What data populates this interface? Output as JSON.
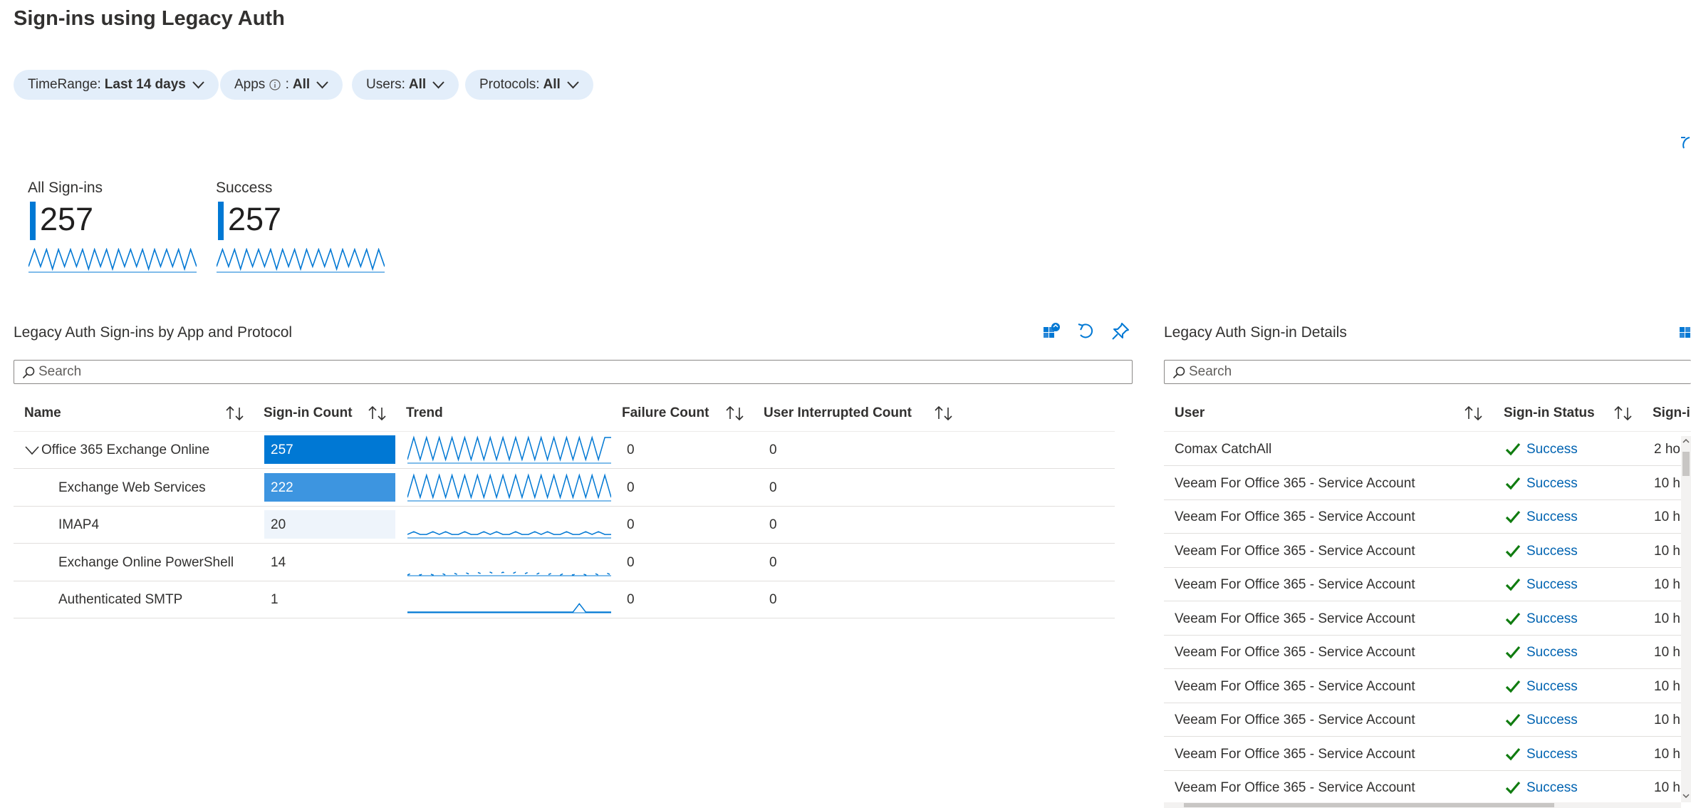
{
  "page": {
    "title": "Sign-ins using Legacy Auth"
  },
  "filters": [
    {
      "label": "TimeRange",
      "value": "Last 14 days",
      "has_info": false
    },
    {
      "label": "Apps",
      "value": "All",
      "has_info": true
    },
    {
      "label": "Users",
      "value": "All",
      "has_info": false
    },
    {
      "label": "Protocols",
      "value": "All",
      "has_info": false
    }
  ],
  "kpis": [
    {
      "label": "All Sign-ins",
      "value": "257",
      "spark": [
        2,
        9,
        2,
        9,
        1,
        9,
        2,
        9,
        2,
        9,
        1,
        9,
        2,
        9,
        1,
        9,
        2,
        9,
        2,
        9,
        1,
        9,
        2,
        9,
        2,
        9,
        1,
        9,
        2
      ]
    },
    {
      "label": "Success",
      "value": "257",
      "spark": [
        2,
        9,
        2,
        9,
        1,
        9,
        2,
        9,
        2,
        9,
        1,
        9,
        2,
        9,
        1,
        9,
        2,
        9,
        2,
        9,
        1,
        9,
        2,
        9,
        2,
        9,
        1,
        9,
        2
      ]
    }
  ],
  "apps_card": {
    "title": "Legacy Auth Sign-ins by App and Protocol",
    "search_placeholder": "Search",
    "columns": [
      "Name",
      "Sign-in Count",
      "Trend",
      "Failure Count",
      "User Interrupted Count"
    ],
    "rows": [
      {
        "name": "Office 365 Exchange Online",
        "count": "257",
        "count_value": 257,
        "failure": "0",
        "interrupted": "0",
        "expandable": true,
        "bar_color": "#0078d4",
        "bar_text_color": "#ffffff",
        "trend": [
          1,
          9,
          1,
          9,
          1,
          9,
          1,
          9,
          1,
          9,
          1,
          9,
          1,
          9,
          1,
          9,
          1,
          9,
          1,
          9,
          1,
          9,
          1,
          9,
          1,
          9,
          1,
          9,
          1,
          9,
          1,
          9,
          9
        ]
      },
      {
        "name": "Exchange Web Services",
        "count": "222",
        "count_value": 222,
        "failure": "0",
        "interrupted": "0",
        "expandable": false,
        "bar_color": "#3d95e0",
        "bar_text_color": "#ffffff",
        "trend": [
          1,
          9,
          1,
          9,
          1,
          9,
          1,
          9,
          1,
          9,
          1,
          9,
          1,
          9,
          1,
          9,
          1,
          9,
          1,
          9,
          1,
          9,
          1,
          9,
          1,
          9,
          1,
          9,
          1,
          9,
          1,
          9,
          1
        ]
      },
      {
        "name": "IMAP4",
        "count": "20",
        "count_value": 20,
        "failure": "0",
        "interrupted": "0",
        "expandable": false,
        "bar_color": "#eef4fb",
        "bar_text_color": "#323130",
        "trend": [
          1,
          2,
          1,
          1,
          2,
          1,
          2,
          1,
          1,
          2,
          1,
          1,
          2,
          1,
          2,
          1,
          1,
          2,
          1,
          1,
          2,
          1,
          2,
          1,
          1,
          2,
          1,
          1,
          2,
          1,
          2,
          1,
          1
        ]
      },
      {
        "name": "Exchange Online PowerShell",
        "count": "14",
        "count_value": 14,
        "failure": "0",
        "interrupted": "0",
        "expandable": false,
        "bar_color": "#ffffff",
        "bar_text_color": "#323130",
        "trend": [
          0,
          1,
          0,
          1,
          0,
          1,
          0,
          1,
          0,
          1,
          0,
          1,
          0,
          1,
          0,
          1,
          0,
          1,
          0,
          1,
          0,
          1,
          0,
          1,
          0,
          1,
          0,
          1,
          0,
          1,
          0,
          1,
          0
        ]
      },
      {
        "name": "Authenticated SMTP",
        "count": "1",
        "count_value": 1,
        "failure": "0",
        "interrupted": "0",
        "expandable": false,
        "bar_color": "#ffffff",
        "bar_text_color": "#323130",
        "trend": [
          0,
          0,
          0,
          0,
          0,
          0,
          0,
          0,
          0,
          0,
          0,
          0,
          0,
          0,
          0,
          0,
          0,
          0,
          0,
          0,
          0,
          0,
          0,
          0,
          0,
          0,
          0,
          1,
          0,
          0,
          0,
          0,
          0
        ]
      }
    ]
  },
  "details_card": {
    "title": "Legacy Auth Sign-in Details",
    "search_placeholder": "Search",
    "columns": [
      "User",
      "Sign-in Status",
      "Sign-i"
    ],
    "rows": [
      {
        "user": "Comax CatchAll",
        "status": "Success",
        "time": "2 ho"
      },
      {
        "user": "Veeam For Office 365 - Service Account",
        "status": "Success",
        "time": "10 h"
      },
      {
        "user": "Veeam For Office 365 - Service Account",
        "status": "Success",
        "time": "10 h"
      },
      {
        "user": "Veeam For Office 365 - Service Account",
        "status": "Success",
        "time": "10 h"
      },
      {
        "user": "Veeam For Office 365 - Service Account",
        "status": "Success",
        "time": "10 h"
      },
      {
        "user": "Veeam For Office 365 - Service Account",
        "status": "Success",
        "time": "10 h"
      },
      {
        "user": "Veeam For Office 365 - Service Account",
        "status": "Success",
        "time": "10 h"
      },
      {
        "user": "Veeam For Office 365 - Service Account",
        "status": "Success",
        "time": "10 h"
      },
      {
        "user": "Veeam For Office 365 - Service Account",
        "status": "Success",
        "time": "10 h"
      },
      {
        "user": "Veeam For Office 365 - Service Account",
        "status": "Success",
        "time": "10 h"
      },
      {
        "user": "Veeam For Office 365 - Service Account",
        "status": "Success",
        "time": "10 h"
      }
    ]
  },
  "colors": {
    "accent": "#0078d4",
    "success": "#107c10",
    "link": "#0063b1",
    "pill": "#e3eefa"
  }
}
